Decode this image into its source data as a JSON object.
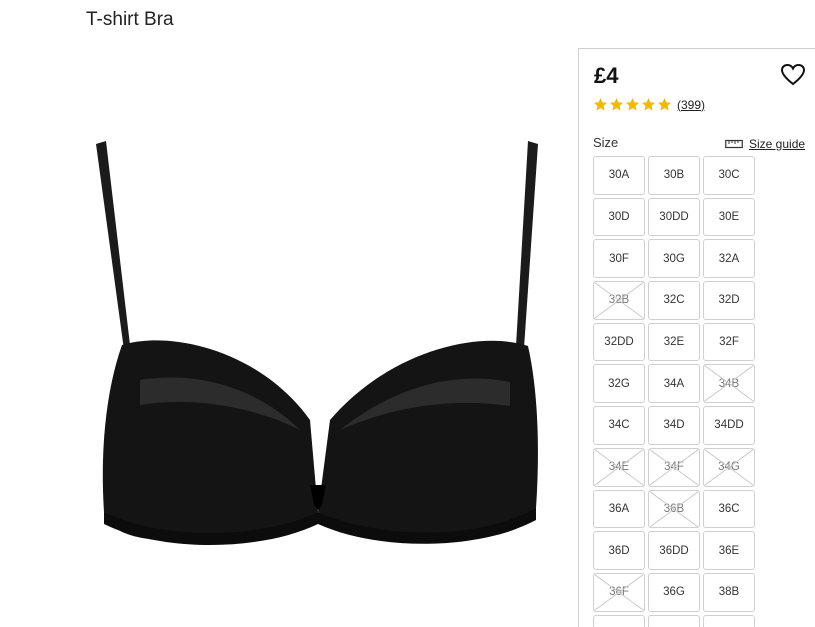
{
  "product": {
    "title": "T-shirt Bra",
    "price": "£4",
    "rating_stars": 5,
    "reviews_count": "(399)",
    "image_icon": "bra-product-image",
    "star_color": "#f5b800"
  },
  "size_section": {
    "label": "Size",
    "guide_label": "Size guide",
    "guide_icon": "ruler-icon",
    "sizes": [
      {
        "label": "30A",
        "available": true
      },
      {
        "label": "30B",
        "available": true
      },
      {
        "label": "30C",
        "available": true
      },
      {
        "label": "30D",
        "available": true
      },
      {
        "label": "30DD",
        "available": true
      },
      {
        "label": "30E",
        "available": true
      },
      {
        "label": "30F",
        "available": true
      },
      {
        "label": "30G",
        "available": true
      },
      {
        "label": "32A",
        "available": true
      },
      {
        "label": "32B",
        "available": false
      },
      {
        "label": "32C",
        "available": true
      },
      {
        "label": "32D",
        "available": true
      },
      {
        "label": "32DD",
        "available": true
      },
      {
        "label": "32E",
        "available": true
      },
      {
        "label": "32F",
        "available": true
      },
      {
        "label": "32G",
        "available": true
      },
      {
        "label": "34A",
        "available": true
      },
      {
        "label": "34B",
        "available": false
      },
      {
        "label": "34C",
        "available": true
      },
      {
        "label": "34D",
        "available": true
      },
      {
        "label": "34DD",
        "available": true
      },
      {
        "label": "34E",
        "available": false
      },
      {
        "label": "34F",
        "available": false
      },
      {
        "label": "34G",
        "available": false
      },
      {
        "label": "36A",
        "available": true
      },
      {
        "label": "36B",
        "available": false
      },
      {
        "label": "36C",
        "available": true
      },
      {
        "label": "36D",
        "available": true
      },
      {
        "label": "36DD",
        "available": true
      },
      {
        "label": "36E",
        "available": true
      },
      {
        "label": "36F",
        "available": false
      },
      {
        "label": "36G",
        "available": true
      },
      {
        "label": "38B",
        "available": true
      },
      {
        "label": "",
        "available": true
      },
      {
        "label": "",
        "available": true
      },
      {
        "label": "",
        "available": true
      }
    ]
  }
}
